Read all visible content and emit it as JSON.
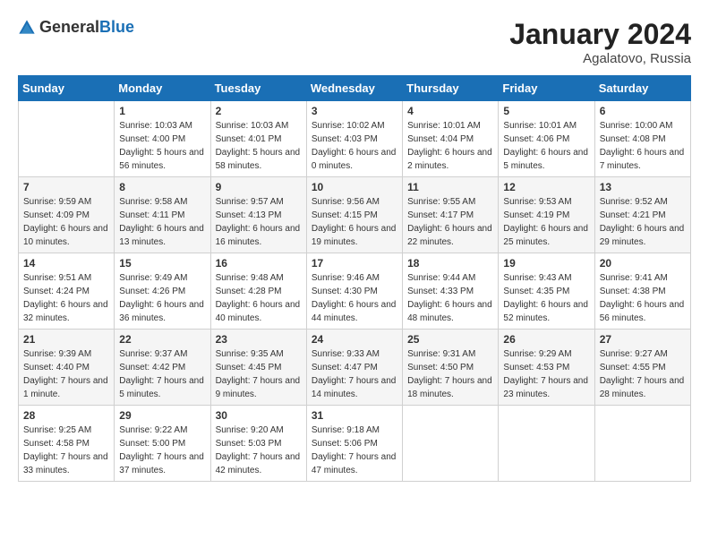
{
  "header": {
    "logo_general": "General",
    "logo_blue": "Blue",
    "month_year": "January 2024",
    "location": "Agalatovo, Russia"
  },
  "days_of_week": [
    "Sunday",
    "Monday",
    "Tuesday",
    "Wednesday",
    "Thursday",
    "Friday",
    "Saturday"
  ],
  "weeks": [
    [
      {
        "day": "",
        "sunrise": "",
        "sunset": "",
        "daylight": ""
      },
      {
        "day": "1",
        "sunrise": "Sunrise: 10:03 AM",
        "sunset": "Sunset: 4:00 PM",
        "daylight": "Daylight: 5 hours and 56 minutes."
      },
      {
        "day": "2",
        "sunrise": "Sunrise: 10:03 AM",
        "sunset": "Sunset: 4:01 PM",
        "daylight": "Daylight: 5 hours and 58 minutes."
      },
      {
        "day": "3",
        "sunrise": "Sunrise: 10:02 AM",
        "sunset": "Sunset: 4:03 PM",
        "daylight": "Daylight: 6 hours and 0 minutes."
      },
      {
        "day": "4",
        "sunrise": "Sunrise: 10:01 AM",
        "sunset": "Sunset: 4:04 PM",
        "daylight": "Daylight: 6 hours and 2 minutes."
      },
      {
        "day": "5",
        "sunrise": "Sunrise: 10:01 AM",
        "sunset": "Sunset: 4:06 PM",
        "daylight": "Daylight: 6 hours and 5 minutes."
      },
      {
        "day": "6",
        "sunrise": "Sunrise: 10:00 AM",
        "sunset": "Sunset: 4:08 PM",
        "daylight": "Daylight: 6 hours and 7 minutes."
      }
    ],
    [
      {
        "day": "7",
        "sunrise": "Sunrise: 9:59 AM",
        "sunset": "Sunset: 4:09 PM",
        "daylight": "Daylight: 6 hours and 10 minutes."
      },
      {
        "day": "8",
        "sunrise": "Sunrise: 9:58 AM",
        "sunset": "Sunset: 4:11 PM",
        "daylight": "Daylight: 6 hours and 13 minutes."
      },
      {
        "day": "9",
        "sunrise": "Sunrise: 9:57 AM",
        "sunset": "Sunset: 4:13 PM",
        "daylight": "Daylight: 6 hours and 16 minutes."
      },
      {
        "day": "10",
        "sunrise": "Sunrise: 9:56 AM",
        "sunset": "Sunset: 4:15 PM",
        "daylight": "Daylight: 6 hours and 19 minutes."
      },
      {
        "day": "11",
        "sunrise": "Sunrise: 9:55 AM",
        "sunset": "Sunset: 4:17 PM",
        "daylight": "Daylight: 6 hours and 22 minutes."
      },
      {
        "day": "12",
        "sunrise": "Sunrise: 9:53 AM",
        "sunset": "Sunset: 4:19 PM",
        "daylight": "Daylight: 6 hours and 25 minutes."
      },
      {
        "day": "13",
        "sunrise": "Sunrise: 9:52 AM",
        "sunset": "Sunset: 4:21 PM",
        "daylight": "Daylight: 6 hours and 29 minutes."
      }
    ],
    [
      {
        "day": "14",
        "sunrise": "Sunrise: 9:51 AM",
        "sunset": "Sunset: 4:24 PM",
        "daylight": "Daylight: 6 hours and 32 minutes."
      },
      {
        "day": "15",
        "sunrise": "Sunrise: 9:49 AM",
        "sunset": "Sunset: 4:26 PM",
        "daylight": "Daylight: 6 hours and 36 minutes."
      },
      {
        "day": "16",
        "sunrise": "Sunrise: 9:48 AM",
        "sunset": "Sunset: 4:28 PM",
        "daylight": "Daylight: 6 hours and 40 minutes."
      },
      {
        "day": "17",
        "sunrise": "Sunrise: 9:46 AM",
        "sunset": "Sunset: 4:30 PM",
        "daylight": "Daylight: 6 hours and 44 minutes."
      },
      {
        "day": "18",
        "sunrise": "Sunrise: 9:44 AM",
        "sunset": "Sunset: 4:33 PM",
        "daylight": "Daylight: 6 hours and 48 minutes."
      },
      {
        "day": "19",
        "sunrise": "Sunrise: 9:43 AM",
        "sunset": "Sunset: 4:35 PM",
        "daylight": "Daylight: 6 hours and 52 minutes."
      },
      {
        "day": "20",
        "sunrise": "Sunrise: 9:41 AM",
        "sunset": "Sunset: 4:38 PM",
        "daylight": "Daylight: 6 hours and 56 minutes."
      }
    ],
    [
      {
        "day": "21",
        "sunrise": "Sunrise: 9:39 AM",
        "sunset": "Sunset: 4:40 PM",
        "daylight": "Daylight: 7 hours and 1 minute."
      },
      {
        "day": "22",
        "sunrise": "Sunrise: 9:37 AM",
        "sunset": "Sunset: 4:42 PM",
        "daylight": "Daylight: 7 hours and 5 minutes."
      },
      {
        "day": "23",
        "sunrise": "Sunrise: 9:35 AM",
        "sunset": "Sunset: 4:45 PM",
        "daylight": "Daylight: 7 hours and 9 minutes."
      },
      {
        "day": "24",
        "sunrise": "Sunrise: 9:33 AM",
        "sunset": "Sunset: 4:47 PM",
        "daylight": "Daylight: 7 hours and 14 minutes."
      },
      {
        "day": "25",
        "sunrise": "Sunrise: 9:31 AM",
        "sunset": "Sunset: 4:50 PM",
        "daylight": "Daylight: 7 hours and 18 minutes."
      },
      {
        "day": "26",
        "sunrise": "Sunrise: 9:29 AM",
        "sunset": "Sunset: 4:53 PM",
        "daylight": "Daylight: 7 hours and 23 minutes."
      },
      {
        "day": "27",
        "sunrise": "Sunrise: 9:27 AM",
        "sunset": "Sunset: 4:55 PM",
        "daylight": "Daylight: 7 hours and 28 minutes."
      }
    ],
    [
      {
        "day": "28",
        "sunrise": "Sunrise: 9:25 AM",
        "sunset": "Sunset: 4:58 PM",
        "daylight": "Daylight: 7 hours and 33 minutes."
      },
      {
        "day": "29",
        "sunrise": "Sunrise: 9:22 AM",
        "sunset": "Sunset: 5:00 PM",
        "daylight": "Daylight: 7 hours and 37 minutes."
      },
      {
        "day": "30",
        "sunrise": "Sunrise: 9:20 AM",
        "sunset": "Sunset: 5:03 PM",
        "daylight": "Daylight: 7 hours and 42 minutes."
      },
      {
        "day": "31",
        "sunrise": "Sunrise: 9:18 AM",
        "sunset": "Sunset: 5:06 PM",
        "daylight": "Daylight: 7 hours and 47 minutes."
      },
      {
        "day": "",
        "sunrise": "",
        "sunset": "",
        "daylight": ""
      },
      {
        "day": "",
        "sunrise": "",
        "sunset": "",
        "daylight": ""
      },
      {
        "day": "",
        "sunrise": "",
        "sunset": "",
        "daylight": ""
      }
    ]
  ]
}
